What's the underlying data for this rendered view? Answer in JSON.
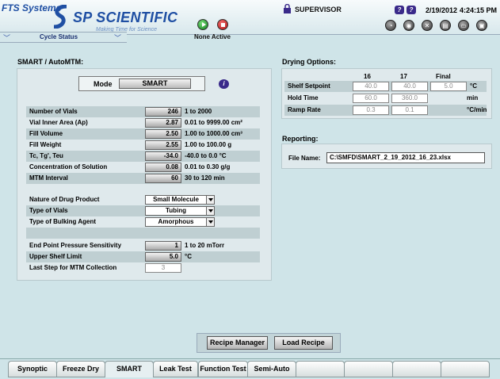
{
  "header": {
    "brand_top": "FTS Systems",
    "brand_main": "SP SCIENTIFIC",
    "tagline": "Making Time for Science",
    "cycle_status": "Cycle Status",
    "none_active": "None Active",
    "user": "SUPERVISOR",
    "date": "2/19/2012",
    "time": "4:24:15 PM",
    "help_icons": [
      "?",
      "?"
    ],
    "tool_icons": [
      "dial-icon",
      "alarm-icon",
      "tools-icon",
      "chart-icon",
      "print-icon",
      "save-icon"
    ]
  },
  "smart": {
    "title": "SMART / AutoMTM:",
    "mode_label": "Mode",
    "mode_value": "SMART",
    "params": [
      {
        "label": "Number of Vials",
        "value": "246",
        "range": "1 to 2000"
      },
      {
        "label": "Vial Inner Area (Ap)",
        "value": "2.87",
        "range": "0.01 to 9999.00 cm²"
      },
      {
        "label": "Fill Volume",
        "value": "2.50",
        "range": "1.00 to 1000.00 cm³"
      },
      {
        "label": "Fill Weight",
        "value": "2.55",
        "range": "1.00 to 100.00 g"
      },
      {
        "label": "Tc, Tg', Teu",
        "value": "-34.0",
        "range": "-40.0 to 0.0 °C"
      },
      {
        "label": "Concentration of Solution",
        "value": "0.08",
        "range": "0.01 to 0.30 g/g"
      },
      {
        "label": "MTM Interval",
        "value": "60",
        "range": "30 to 120 min"
      }
    ],
    "selects": [
      {
        "label": "Nature of Drug Product",
        "value": "Small Molecule"
      },
      {
        "label": "Type of Vials",
        "value": "Tubing"
      },
      {
        "label": "Type of Bulking Agent",
        "value": "Amorphous"
      }
    ],
    "endpoint": {
      "label": "End Point Pressure Sensitivity",
      "value": "1",
      "range": "1 to 20 mTorr"
    },
    "shelf": {
      "label": "Upper Shelf Limit",
      "value": "5.0",
      "range": "°C"
    },
    "laststep": {
      "label": "Last Step for MTM Collection",
      "value": "3"
    }
  },
  "drying": {
    "title": "Drying Options:",
    "columns": [
      "16",
      "17",
      "Final"
    ],
    "rows": [
      {
        "label": "Shelf Setpoint",
        "values": [
          "40.0",
          "40.0",
          "5.0"
        ],
        "unit": "°C"
      },
      {
        "label": "Hold Time",
        "values": [
          "60.0",
          "360.0",
          ""
        ],
        "unit": "min"
      },
      {
        "label": "Ramp Rate",
        "values": [
          "0.3",
          "0.1",
          ""
        ],
        "unit": "°C/min"
      }
    ]
  },
  "reporting": {
    "title": "Reporting:",
    "file_label": "File Name:",
    "file_value": "C:\\SMFD\\SMART_2_19_2012_16_23.xlsx"
  },
  "actions": {
    "recipe_manager": "Recipe Manager",
    "load_recipe": "Load Recipe"
  },
  "tabs": [
    "Synoptic",
    "Freeze Dry",
    "SMART",
    "Leak Test",
    "Function Test",
    "Semi-Auto",
    "",
    "",
    "",
    "",
    ""
  ]
}
